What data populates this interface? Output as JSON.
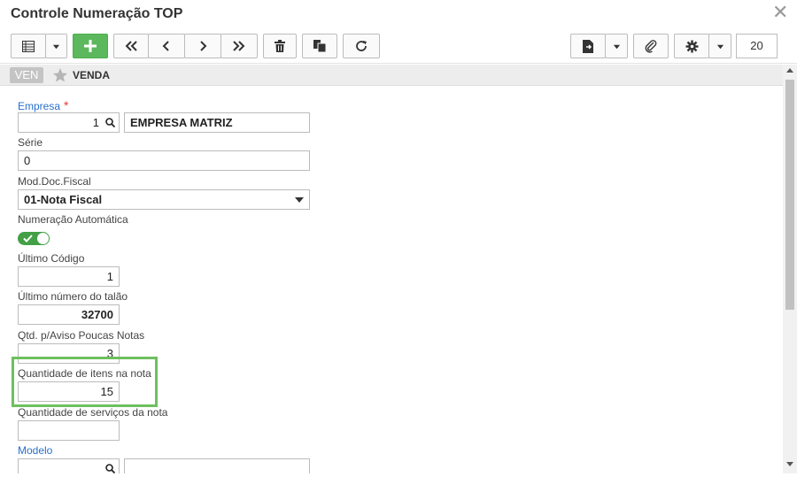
{
  "window": {
    "title": "Controle Numeração TOP",
    "close_glyph": "✕"
  },
  "toolbar": {
    "page_size": "20",
    "icons": [
      "grid-icon",
      "add-icon",
      "first-icon",
      "previous-icon",
      "next-icon",
      "last-icon",
      "delete-icon",
      "copy-icon",
      "refresh-icon",
      "export-icon",
      "attach-icon",
      "gear-icon"
    ],
    "add_color": "#5cb85c"
  },
  "tagbar": {
    "code": "VEN",
    "label": "VENDA"
  },
  "form": {
    "empresa": {
      "label": "Empresa",
      "required_mark": "*",
      "code": "1",
      "name": "EMPRESA MATRIZ"
    },
    "serie": {
      "label": "Série",
      "value": "0"
    },
    "mod_doc_fiscal": {
      "label": "Mod.Doc.Fiscal",
      "value": "01-Nota Fiscal"
    },
    "numeracao_automatica": {
      "label": "Numeração Automática",
      "enabled": true
    },
    "ultimo_codigo": {
      "label": "Último Código",
      "value": "1"
    },
    "ultimo_numero_talao": {
      "label": "Último número do talão",
      "value": "32700"
    },
    "qtd_aviso": {
      "label": "Qtd. p/Aviso Poucas Notas",
      "value": "3"
    },
    "qtd_itens_nota": {
      "label": "Quantidade de itens na nota",
      "value": "15"
    },
    "qtd_servicos_nota": {
      "label": "Quantidade de serviços da nota",
      "value": ""
    },
    "modelo": {
      "label": "Modelo",
      "code": "",
      "name": ""
    }
  },
  "colors": {
    "link": "#2a6fc9",
    "required": "#e53935",
    "toggle_on": "#43a047",
    "highlight": "#6ec05f"
  }
}
